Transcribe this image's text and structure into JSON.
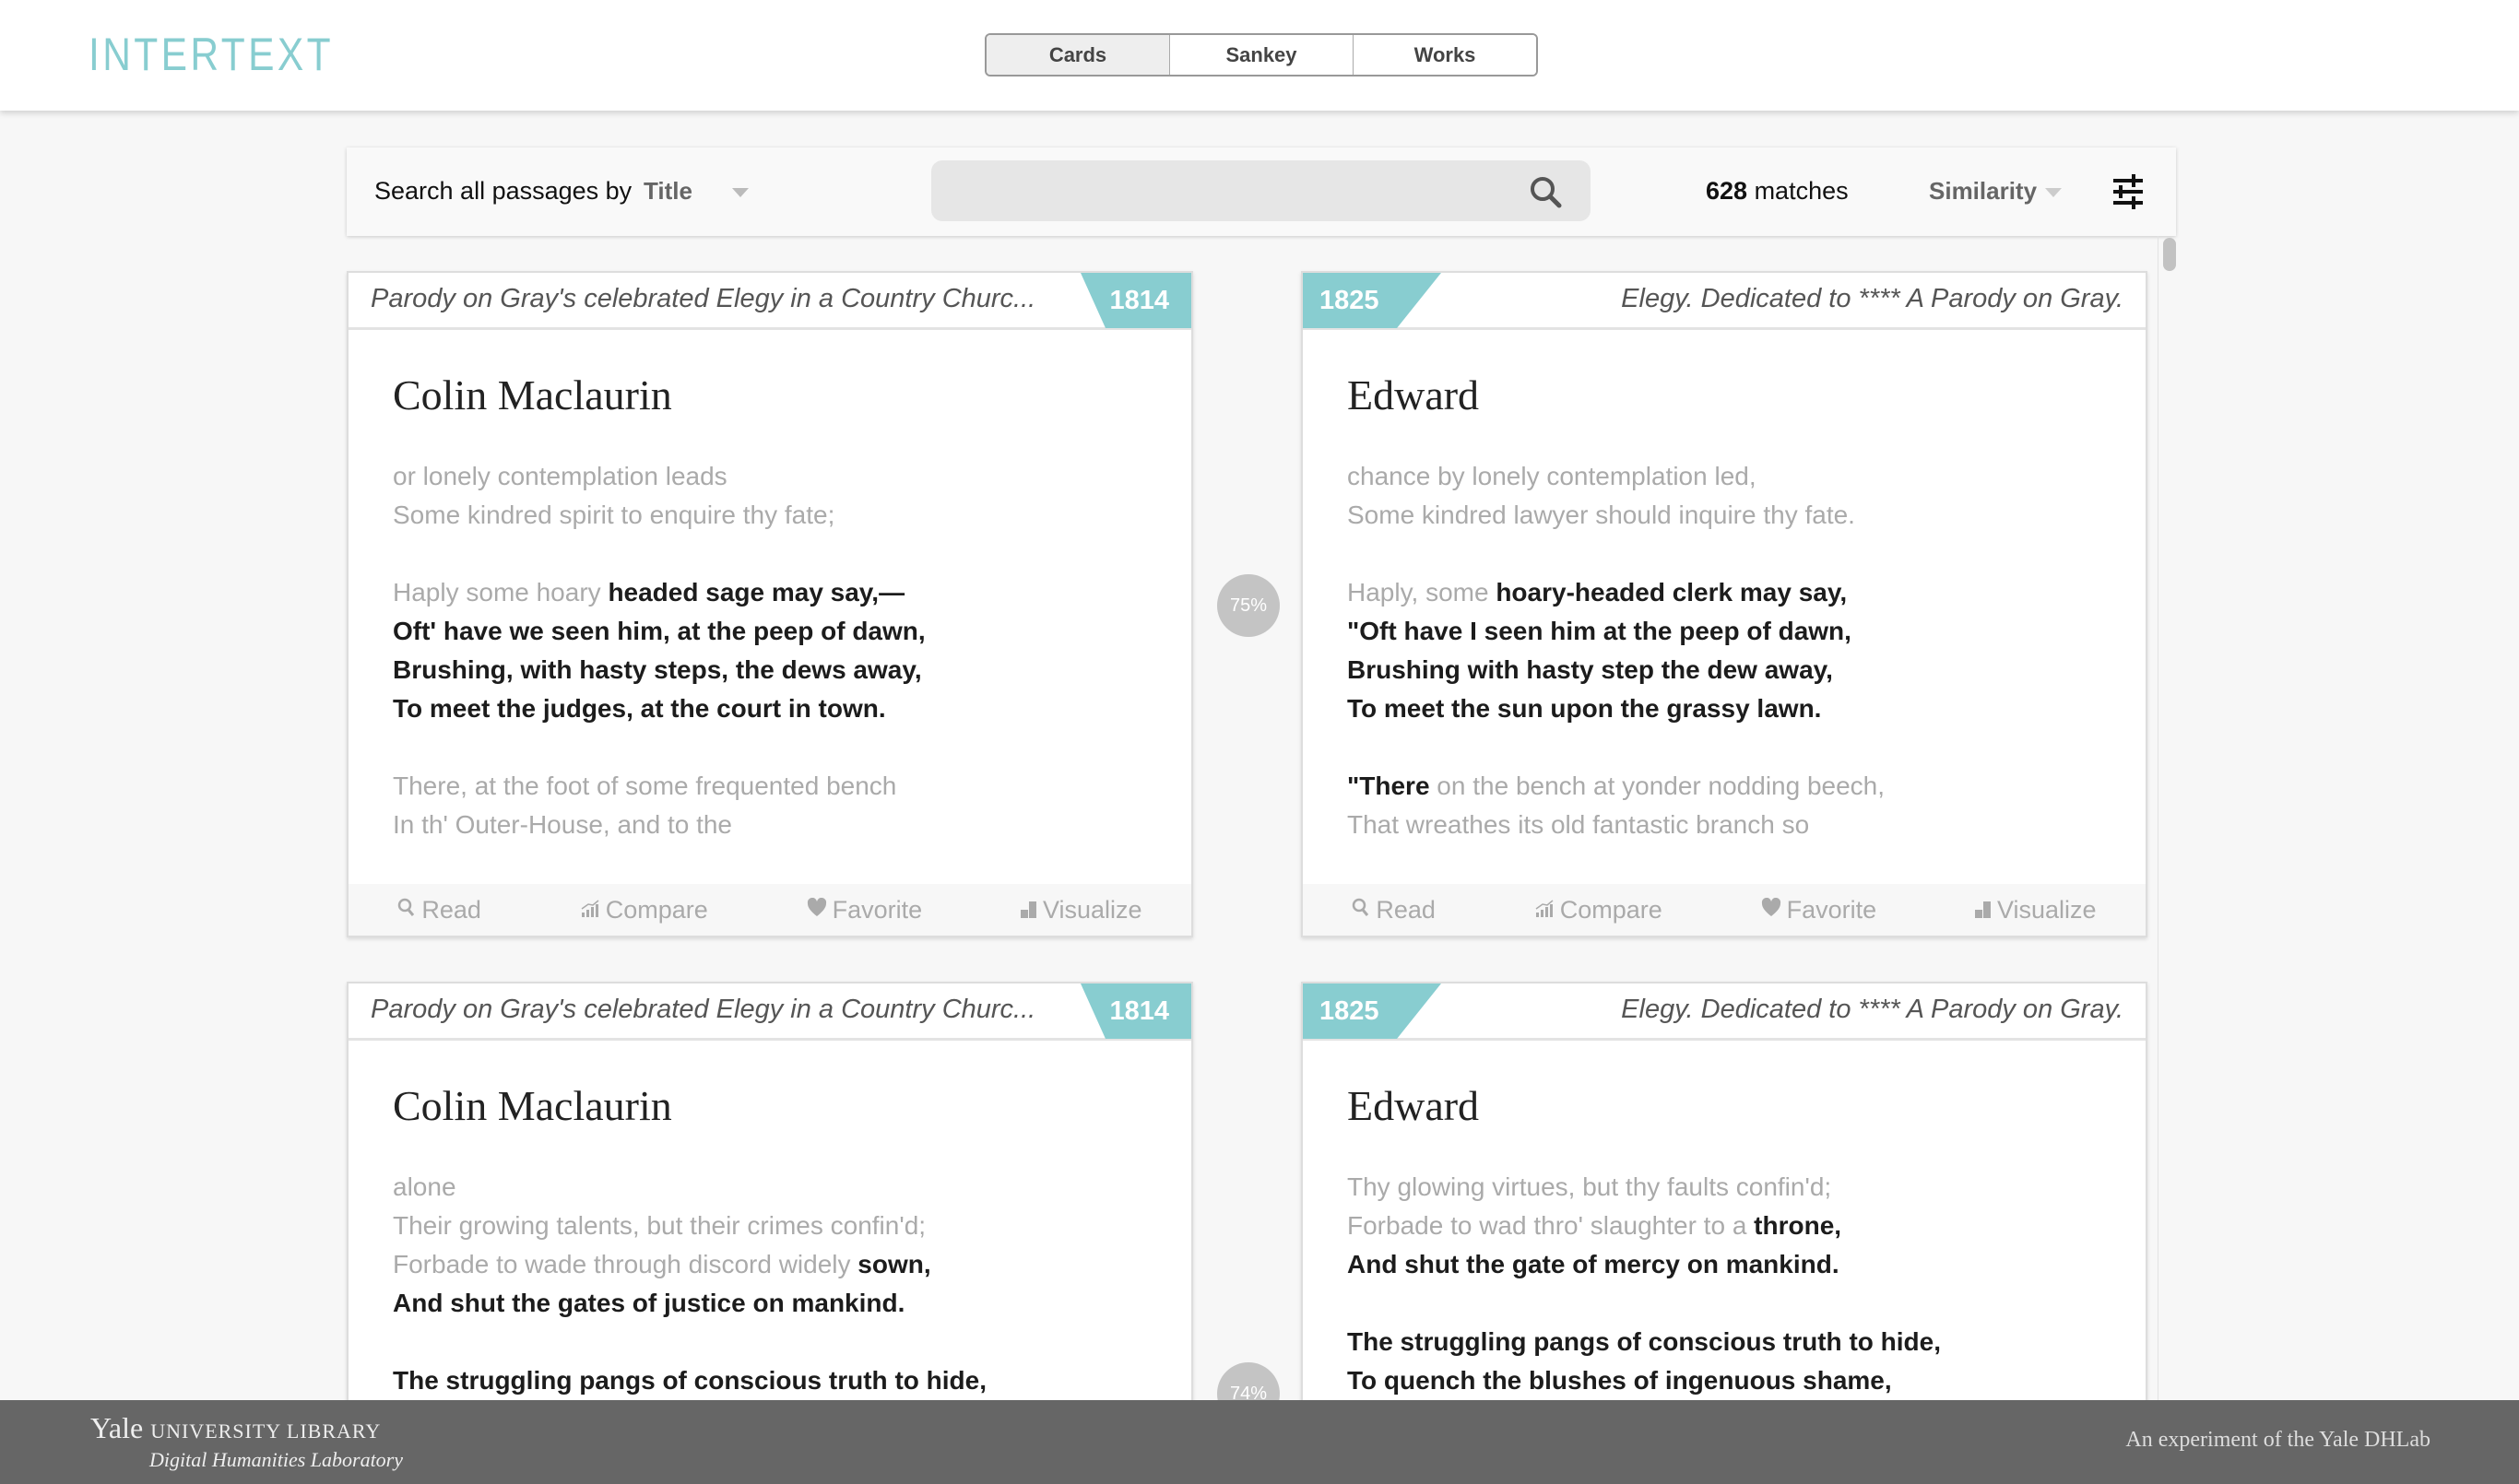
{
  "header": {
    "logo": "INTERTEXT",
    "tabs": [
      {
        "label": "Cards",
        "active": true
      },
      {
        "label": "Sankey"
      },
      {
        "label": "Works"
      }
    ]
  },
  "toolbar": {
    "search_label": "Search all passages by",
    "search_field": "Title",
    "search_value": "",
    "match_count": "628",
    "match_label": " matches",
    "sort": "Similarity",
    "icons": [
      "search-icon",
      "sliders-icon",
      "caret-down-icon"
    ]
  },
  "colors": {
    "accent": "#88cdd0",
    "footer": "#666666",
    "similarity": "#c4c4c4"
  },
  "actions": [
    {
      "label": "Read",
      "icon": "search-icon"
    },
    {
      "label": "Compare",
      "icon": "chart-icon"
    },
    {
      "label": "Favorite",
      "icon": "heart-icon"
    },
    {
      "label": "Visualize",
      "icon": "blocks-icon"
    }
  ],
  "pairs": [
    {
      "similarity": "75%",
      "left": {
        "title": "Parody on Gray's celebrated Elegy in a Country Churc...",
        "year": "1814",
        "author": "Colin Maclaurin",
        "lines": [
          [
            {
              "t": "or lonely contemplation leads"
            }
          ],
          [
            {
              "t": "Some kindred spirit to enquire thy fate;"
            }
          ],
          [],
          [
            {
              "t": "Haply some hoary "
            },
            {
              "t": "headed sage may say,—",
              "b": true
            }
          ],
          [
            {
              "t": "Oft' have we seen him, at the peep of dawn,",
              "b": true
            }
          ],
          [
            {
              "t": "Brushing, with hasty steps, the dews away,",
              "b": true
            }
          ],
          [
            {
              "t": "To meet the judges, at the court in town.",
              "b": true
            }
          ],
          [],
          [
            {
              "t": "There, at the foot of some frequented bench"
            }
          ],
          [
            {
              "t": "In th' Outer-House, and to the"
            }
          ]
        ]
      },
      "right": {
        "title": "Elegy. Dedicated to **** A Parody on Gray.",
        "year": "1825",
        "author": "Edward",
        "lines": [
          [
            {
              "t": "chance by lonely contemplation led,"
            }
          ],
          [
            {
              "t": "Some kindred lawyer should inquire thy fate."
            }
          ],
          [],
          [
            {
              "t": "Haply, some "
            },
            {
              "t": "hoary-headed clerk may say,",
              "b": true
            }
          ],
          [
            {
              "t": "\"Oft have I seen him at the peep of dawn,",
              "b": true
            }
          ],
          [
            {
              "t": "Brushing with hasty step the dew away,",
              "b": true
            }
          ],
          [
            {
              "t": "To meet the sun upon the grassy lawn.",
              "b": true
            }
          ],
          [],
          [
            {
              "t": "\"There",
              "b": true
            },
            {
              "t": " on the bench at yonder nodding beech,"
            }
          ],
          [
            {
              "t": "That wreathes its old fantastic branch so"
            }
          ]
        ]
      }
    },
    {
      "similarity": "74%",
      "left": {
        "title": "Parody on Gray's celebrated Elegy in a Country Churc...",
        "year": "1814",
        "author": "Colin Maclaurin",
        "lines": [
          [
            {
              "t": "alone"
            }
          ],
          [
            {
              "t": "Their growing talents, but their crimes confin'd;"
            }
          ],
          [
            {
              "t": "Forbade to wade through discord widely "
            },
            {
              "t": "sown,",
              "b": true
            }
          ],
          [
            {
              "t": "And shut the gates of justice on mankind.",
              "b": true
            }
          ],
          [],
          [
            {
              "t": "The struggling pangs of conscious truth to hide,",
              "b": true
            }
          ]
        ]
      },
      "right": {
        "title": "Elegy. Dedicated to **** A Parody on Gray.",
        "year": "1825",
        "author": "Edward",
        "lines": [
          [
            {
              "t": "Thy glowing virtues, but thy faults confin'd;"
            }
          ],
          [
            {
              "t": "Forbade to wad thro' slaughter to a "
            },
            {
              "t": "throne,",
              "b": true
            }
          ],
          [
            {
              "t": "And shut the gate of mercy on mankind.",
              "b": true
            }
          ],
          [],
          [
            {
              "t": "The struggling pangs of conscious truth to hide,",
              "b": true
            }
          ],
          [
            {
              "t": "To quench the blushes of ingenuous shame,",
              "b": true
            }
          ]
        ]
      }
    }
  ],
  "footer": {
    "yale": "Yale",
    "library": "UNIVERSITY LIBRARY",
    "dhlab": "Digital Humanities Laboratory",
    "experiment": "An experiment of the Yale DHLab"
  }
}
